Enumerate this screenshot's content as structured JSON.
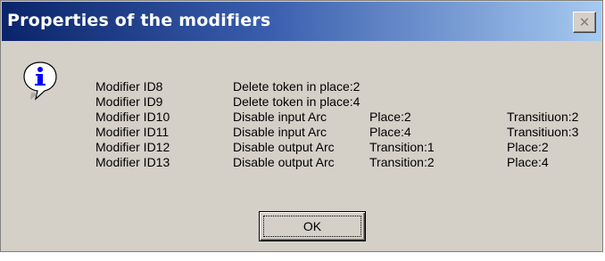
{
  "dialog": {
    "title": "Properties of the modifiers",
    "close_glyph": "✕",
    "icon": "information-icon",
    "ok_label": "OK"
  },
  "modifiers": [
    {
      "id": "Modifier ID8",
      "action": "Delete token in place:2",
      "from": "",
      "to": ""
    },
    {
      "id": "Modifier ID9",
      "action": "Delete token in place:4",
      "from": "",
      "to": ""
    },
    {
      "id": "Modifier ID10",
      "action": "Disable input Arc",
      "from": "Place:2",
      "to": "Transitiuon:2"
    },
    {
      "id": "Modifier ID11",
      "action": "Disable input Arc",
      "from": "Place:4",
      "to": "Transitiuon:3"
    },
    {
      "id": "Modifier ID12",
      "action": "Disable output Arc",
      "from": "Transition:1",
      "to": "Place:2"
    },
    {
      "id": "Modifier ID13",
      "action": "Disable output Arc",
      "from": "Transition:2",
      "to": "Place:4"
    }
  ],
  "colors": {
    "title_bar_start": "#0a246a",
    "title_bar_end": "#a6caf0",
    "dialog_face": "#d4d0c8",
    "icon_blue": "#0000ff"
  }
}
